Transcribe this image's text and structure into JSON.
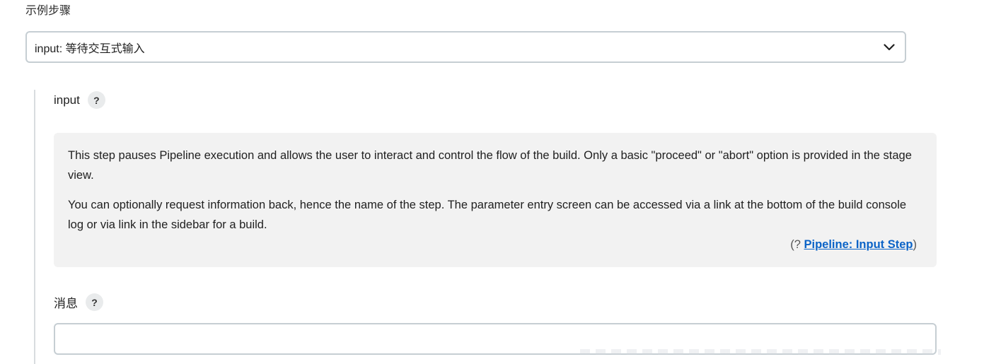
{
  "section": {
    "label": "示例步骤"
  },
  "step_select": {
    "value": "input: 等待交互式输入",
    "icon": "chevron-down-icon"
  },
  "input_field": {
    "label": "input",
    "help_icon": "?"
  },
  "help": {
    "paragraph1": "This step pauses Pipeline execution and allows the user to interact and control the flow of the build. Only a basic \"proceed\" or \"abort\" option is provided in the stage view.",
    "paragraph2": "You can optionally request information back, hence the name of the step. The parameter entry screen can be accessed via a link at the bottom of the build console log or via link in the sidebar for a build.",
    "source_prefix": "(? ",
    "source_link": "Pipeline: Input Step",
    "source_suffix": ")"
  },
  "message_field": {
    "label": "消息",
    "help_icon": "?",
    "value": ""
  }
}
